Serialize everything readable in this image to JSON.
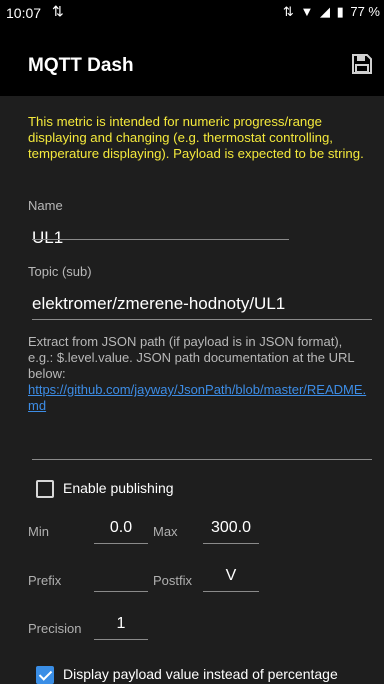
{
  "status_bar": {
    "time": "10:07",
    "battery": "77 %"
  },
  "app_bar": {
    "title": "MQTT Dash",
    "save_icon": "save-icon"
  },
  "form": {
    "info_text": "This metric is intended for numeric progress/range displaying and changing (e.g. thermostat controlling, temperature displaying). Payload is expected to be string.",
    "name_label": "Name",
    "name_value": "UL1",
    "topic_label": "Topic (sub)",
    "topic_value": "elektromer/zmerene-hodnoty/UL1",
    "json_help": "Extract from JSON path (if payload is in JSON format), e.g.: $.level.value. JSON path documentation at the URL below:",
    "json_link": "https://github.com/jayway/JsonPath/blob/master/README.md",
    "json_path_value": "",
    "enable_publishing_label": "Enable publishing",
    "enable_publishing_checked": false,
    "min_label": "Min",
    "min_value": "0.0",
    "max_label": "Max",
    "max_value": "300.0",
    "prefix_label": "Prefix",
    "prefix_value": "",
    "postfix_label": "Postfix",
    "postfix_value": "V",
    "precision_label": "Precision",
    "precision_value": "1",
    "display_payload_label": "Display payload value instead of percentage",
    "display_payload_checked": true
  },
  "colors": {
    "background": "#1e1e1e",
    "bar": "#000000",
    "info_text": "#f4e93c",
    "link": "#3d8de6",
    "accent": "#3a8ee6"
  }
}
